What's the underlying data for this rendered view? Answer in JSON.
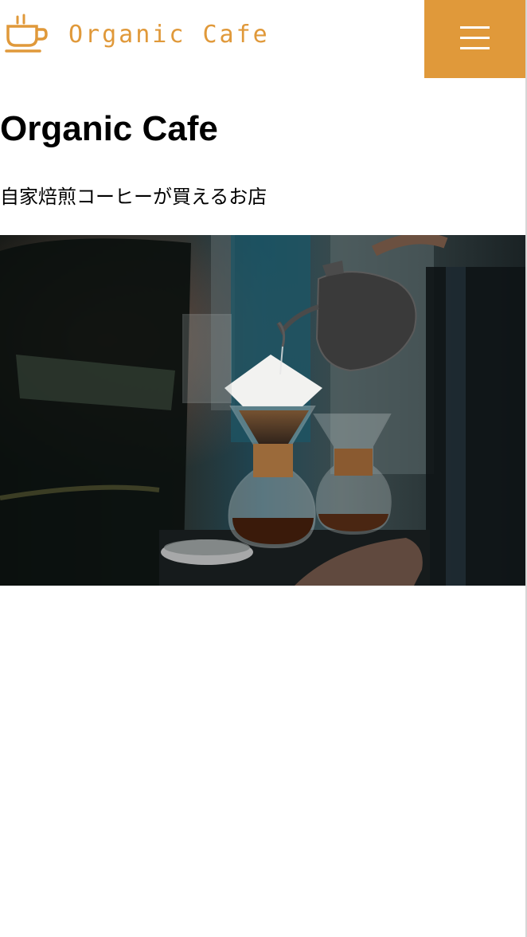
{
  "header": {
    "logo_text": "Organic Cafe",
    "logo_icon": "coffee-cup-icon",
    "menu_icon": "hamburger-icon"
  },
  "main": {
    "title": "Organic Cafe",
    "tagline": "自家焙煎コーヒーが買えるお店",
    "hero_image": "pour-over-coffee-photo"
  },
  "colors": {
    "accent": "#e0993a",
    "background": "#ffffff",
    "text": "#000000"
  }
}
